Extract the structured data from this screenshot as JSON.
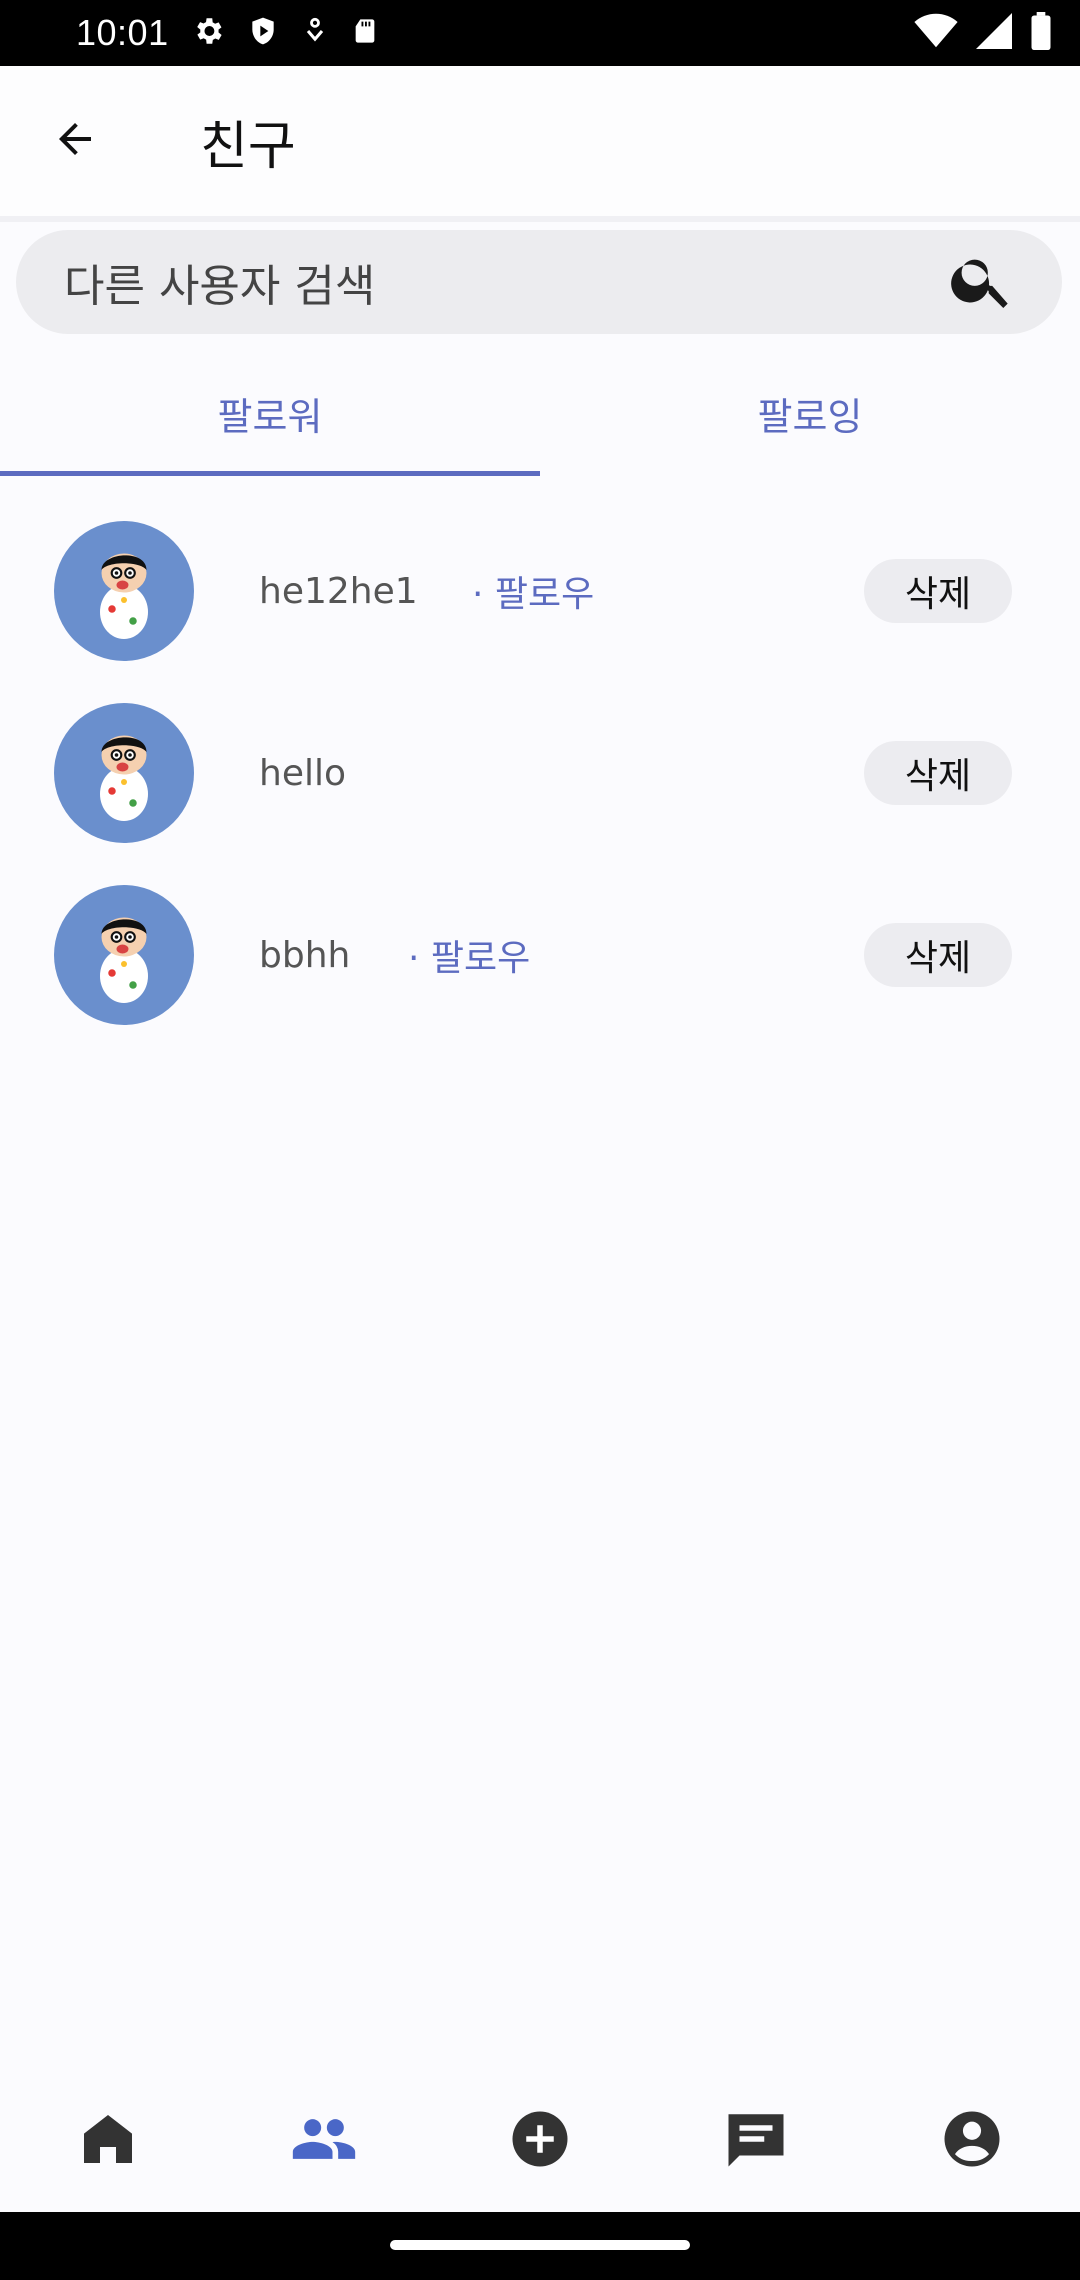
{
  "status_bar": {
    "time": "10:01",
    "left_icons": [
      "gear-icon",
      "shield-icon",
      "download-icon",
      "sd-card-icon"
    ],
    "right_icons": [
      "wifi-icon",
      "signal-icon",
      "battery-icon"
    ]
  },
  "app_bar": {
    "title": "친구",
    "back_icon": "arrow-left-icon"
  },
  "search": {
    "placeholder": "다른 사용자 검색",
    "icon": "search-icon"
  },
  "tabs": [
    {
      "label": "팔로워",
      "active": true
    },
    {
      "label": "팔로잉",
      "active": false
    }
  ],
  "followers": [
    {
      "username": "he12he1",
      "follow_label": "· 팔로우",
      "action": "삭제"
    },
    {
      "username": "hello",
      "follow_label": "",
      "action": "삭제"
    },
    {
      "username": "bbhh",
      "follow_label": "· 팔로우",
      "action": "삭제"
    }
  ],
  "bottom_nav": [
    {
      "icon": "home-icon",
      "active": false
    },
    {
      "icon": "people-icon",
      "active": true
    },
    {
      "icon": "add-circle-icon",
      "active": false
    },
    {
      "icon": "chat-icon",
      "active": false
    },
    {
      "icon": "account-icon",
      "active": false
    }
  ],
  "colors": {
    "accent": "#5c6bc0",
    "avatar_bg": "#6a8fcd",
    "nav_inactive": "#333333",
    "nav_active": "#4a67c7"
  }
}
